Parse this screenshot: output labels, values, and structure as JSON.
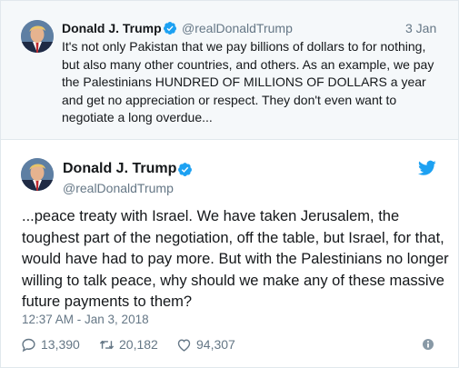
{
  "parent_tweet": {
    "author_name": "Donald J. Trump",
    "handle": "@realDonaldTrump",
    "time": "3 Jan",
    "text": "It's not only Pakistan that we pay billions of dollars to for nothing, but also many other countries, and others. As an example, we pay the Palestinians HUNDRED OF MILLIONS OF DOLLARS a year and get no appreciation or respect. They don't even want to negotiate a long overdue..."
  },
  "main_tweet": {
    "author_name": "Donald J. Trump",
    "handle": "@realDonaldTrump",
    "text": "...peace treaty with Israel. We have taken Jerusalem, the toughest part of the negotiation, off the table, but Israel, for that, would have had to pay more. But with the Palestinians no longer willing to talk peace, why should we make any of these massive future payments to them?",
    "timestamp": "12:37 AM - Jan 3, 2018",
    "replies": "13,390",
    "retweets": "20,182",
    "likes": "94,307"
  },
  "colors": {
    "twitter_blue": "#1da1f2",
    "muted": "#657786",
    "parent_bg": "#f5f8fa",
    "text": "#14171a"
  },
  "icons": [
    "verified-icon",
    "twitter-bird-icon",
    "reply-icon",
    "retweet-icon",
    "like-heart-icon",
    "info-icon"
  ]
}
